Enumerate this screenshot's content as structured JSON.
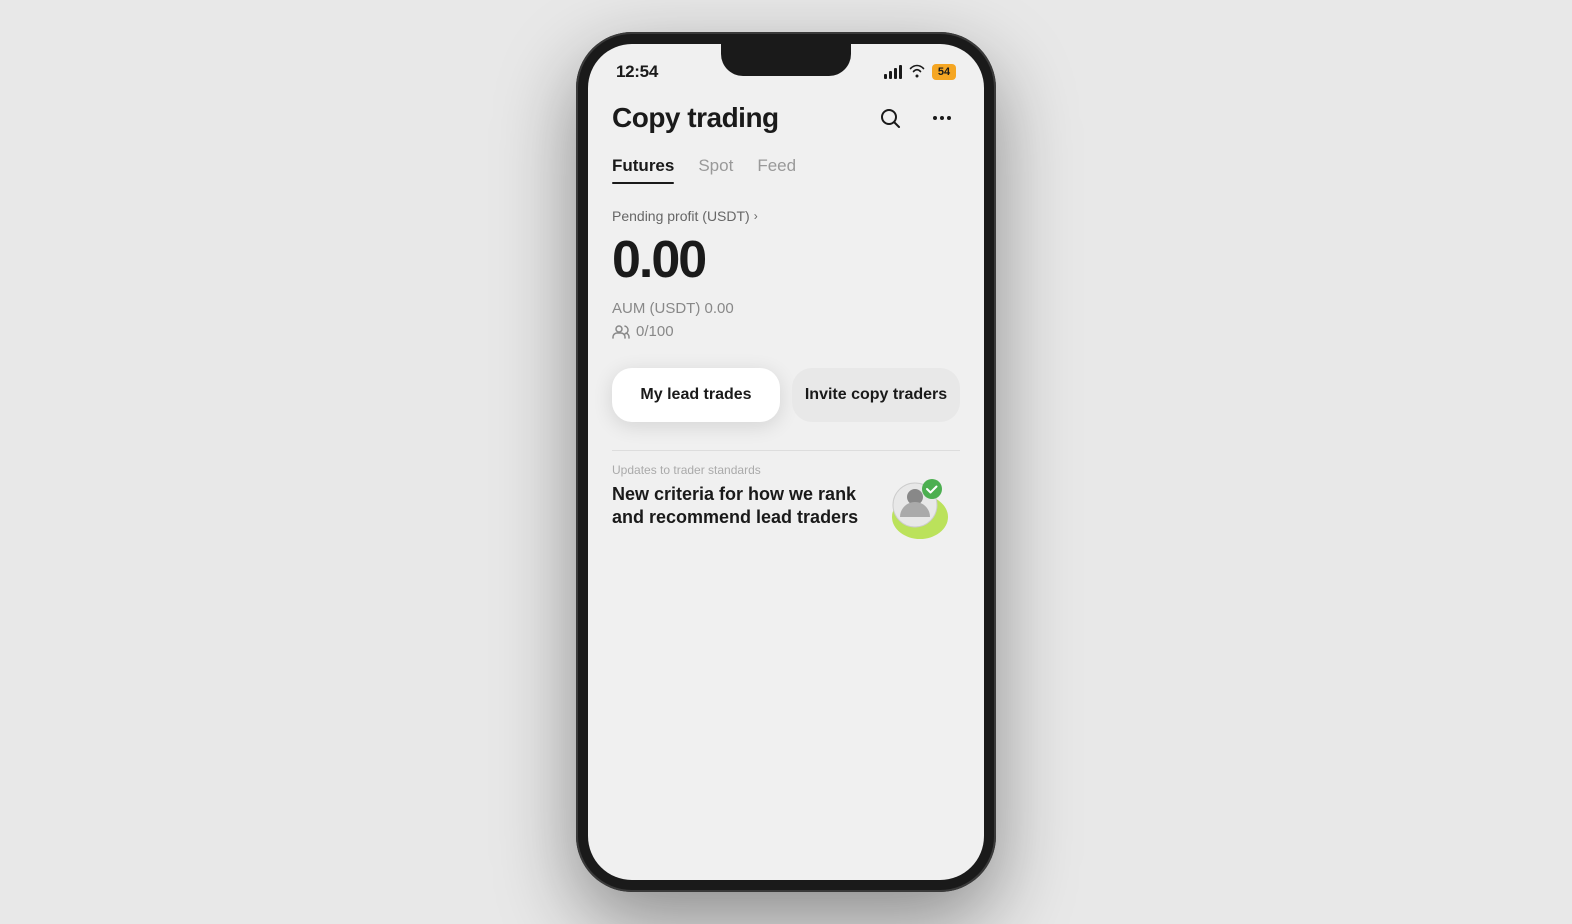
{
  "status_bar": {
    "time": "12:54",
    "battery": "54"
  },
  "header": {
    "title": "Copy trading",
    "search_icon": "search",
    "more_icon": "ellipsis"
  },
  "tabs": [
    {
      "label": "Futures",
      "active": true
    },
    {
      "label": "Spot",
      "active": false
    },
    {
      "label": "Feed",
      "active": false
    }
  ],
  "stats": {
    "pending_profit_label": "Pending profit (USDT)",
    "pending_profit_value": "0.00",
    "aum_label": "AUM (USDT)",
    "aum_value": "0.00",
    "followers_count": "0/100"
  },
  "buttons": {
    "lead_trades": "My lead trades",
    "invite": "Invite copy traders"
  },
  "news": {
    "category": "Updates to trader standards",
    "title": "New criteria for how we rank and recommend lead traders"
  }
}
